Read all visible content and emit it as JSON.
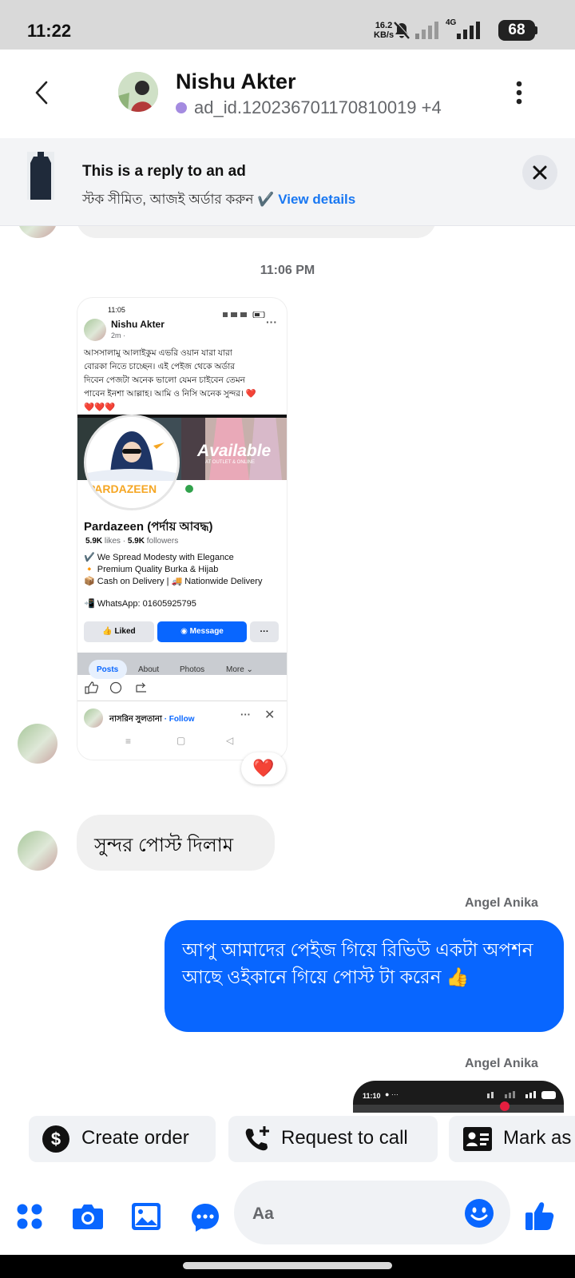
{
  "status_bar": {
    "time": "11:22",
    "net_speed_value": "16.2",
    "net_speed_unit": "KB/s",
    "network": "4G",
    "battery": "68"
  },
  "header": {
    "contact_name": "Nishu Akter",
    "ad_id": "ad_id.120236701170810019 +4"
  },
  "ad_banner": {
    "title": "This is a reply to an ad",
    "text": "স্টক সীমিত, আজই অর্ডার করুন ✔️",
    "view_details": "View details"
  },
  "chat": {
    "timestamp": "11:06 PM",
    "shared_post": {
      "time": "11:05",
      "author": "Nishu Akter",
      "meta": "2m ·",
      "caption_lines": [
        "আসসালামু আলাইকুম এভরি ওয়ান যারা যারা",
        "বোরকা নিতে চাচ্ছেন। এই পেইজ থেকে অর্ডার",
        "দিবেন পেজটা অনেক ভালো যেমন চাইবেন তেমন",
        "পাবেন ইনশা আল্লাহ। আমি ও নিসি অনেক সুন্দর। ❤️",
        "❤️❤️❤️"
      ],
      "cover_available": "Available",
      "cover_sub": "AT OUTLET & ONLINE",
      "logo_text": "PARDAZEEN",
      "page_name": "Pardazeen (পর্দায় আবদ্ধ)",
      "likes": "5.9K",
      "likes_label": "likes",
      "followers": "5.9K",
      "followers_label": "followers",
      "bio_lines": [
        "✔️ We Spread Modesty with Elegance",
        "🔸 Premium Quality Burka & Hijab",
        "📦 Cash on Delivery | 🚚 Nationwide Delivery",
        "📲 WhatsApp: 01605925795"
      ],
      "btn_liked": "Liked",
      "btn_message": "Message",
      "btn_more": "···",
      "tabs": [
        "Posts",
        "About",
        "Photos",
        "More ⌄"
      ],
      "next_author": "নাসরিন সুলতানা",
      "follow": "· Follow"
    },
    "reaction": "❤️",
    "incoming_message": "সুন্দর  পোস্ট দিলাম",
    "sender_1": "Angel Anika",
    "outgoing_message": "আপু আমাদের পেইজ গিয়ে রিভিউ একটা অপশন আছে ওইকানে গিয়ে পোস্ট টা করেন 👍",
    "sender_2": "Angel Anika",
    "preview_time": "11:10"
  },
  "quick_actions": [
    {
      "label": "Create order",
      "icon": "dollar-icon"
    },
    {
      "label": "Request to call",
      "icon": "phone-add-icon"
    },
    {
      "label": "Mark as",
      "icon": "id-card-icon"
    }
  ],
  "composer": {
    "placeholder": "Aa"
  },
  "colors": {
    "accent": "#0866ff",
    "messenger_blue": "#1877f2",
    "bubble_in": "#f0f0f0"
  }
}
